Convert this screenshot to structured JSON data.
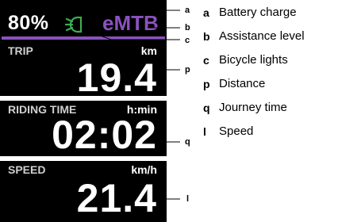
{
  "display": {
    "battery": "80%",
    "mode": "eMTB",
    "trip": {
      "label": "TRIP",
      "unit": "km",
      "value": "19.4"
    },
    "riding_time": {
      "label": "RIDING TIME",
      "unit": "h:min",
      "value": "02:02"
    },
    "speed": {
      "label": "SPEED",
      "unit": "km/h",
      "value": "21.4"
    }
  },
  "callouts": {
    "a": "a",
    "b": "b",
    "c": "c",
    "p": "p",
    "q": "q",
    "l": "l"
  },
  "legend": [
    {
      "key": "a",
      "text": "Battery charge"
    },
    {
      "key": "b",
      "text": "Assistance level"
    },
    {
      "key": "c",
      "text": "Bicycle lights"
    },
    {
      "key": "p",
      "text": "Distance"
    },
    {
      "key": "q",
      "text": "Journey time"
    },
    {
      "key": "l",
      "text": "Speed"
    }
  ],
  "colors": {
    "display_bg": "#000000",
    "mode_accent": "#8a52bf",
    "light_icon": "#3cae4e"
  }
}
